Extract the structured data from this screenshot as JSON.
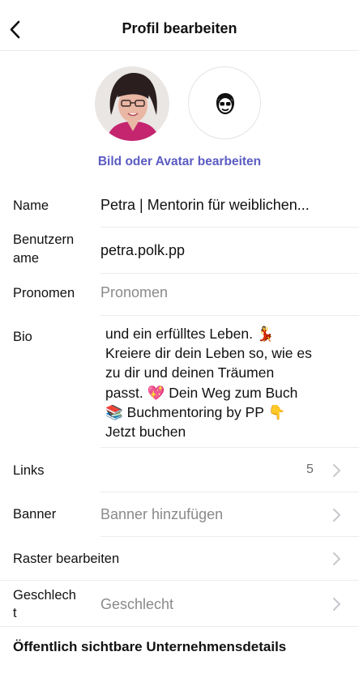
{
  "header": {
    "title": "Profil bearbeiten",
    "back_icon": "chevron-left-icon"
  },
  "avatar": {
    "edit_link": "Bild oder Avatar bearbeiten",
    "character_icon": "avatar-character-icon"
  },
  "fields": {
    "name": {
      "label": "Name",
      "value": "Petra | Mentorin für weiblichen..."
    },
    "username": {
      "label_line1": "Benutzern",
      "label_line2": "ame",
      "value": "petra.polk.pp"
    },
    "pronouns": {
      "label": "Pronomen",
      "placeholder": "Pronomen"
    },
    "bio": {
      "label": "Bio",
      "lines": [
        "und ein erfülltes Leben. 💃",
        "Kreiere dir dein Leben so, wie es",
        "zu dir und deinen Träumen",
        "passt. 💖 Dein Weg zum Buch",
        "📚 Buchmentoring by PP 👇",
        "Jetzt buchen"
      ]
    },
    "links": {
      "label": "Links",
      "count": "5"
    },
    "banner": {
      "label": "Banner",
      "placeholder": "Banner hinzufügen"
    },
    "grid": {
      "label": "Raster bearbeiten"
    },
    "gender": {
      "label_line1": "Geschlech",
      "label_line2": "t",
      "placeholder": "Geschlecht"
    }
  },
  "section": {
    "business_details": "Öffentlich sichtbare Unternehmensdetails"
  },
  "colors": {
    "accent": "#5b5cc2",
    "placeholder": "#8a8a8a",
    "divider": "#ececec",
    "chevron": "#c7c7cc"
  }
}
